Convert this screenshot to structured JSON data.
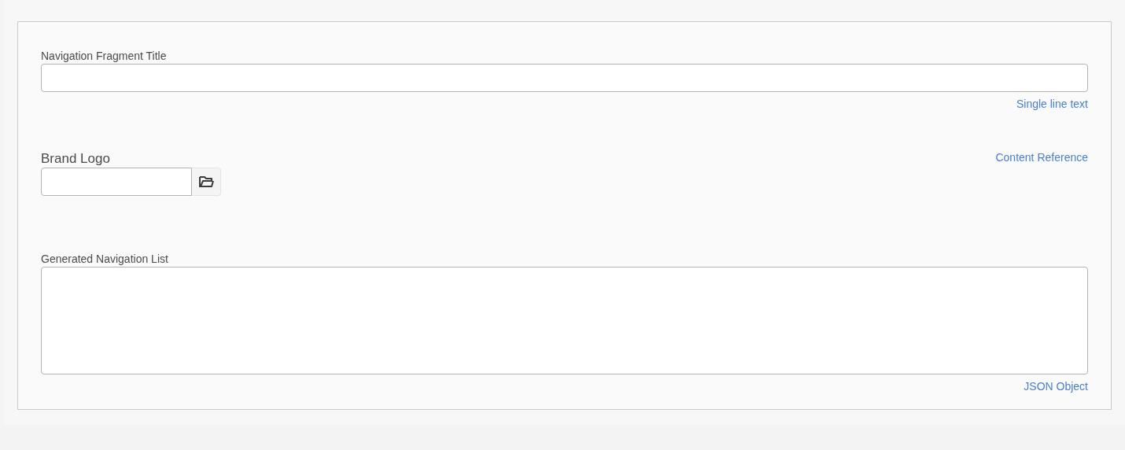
{
  "fields": [
    {
      "kind": "text",
      "label": "Navigation Fragment Title",
      "type_label": "Single line text"
    },
    {
      "kind": "reference",
      "label": "Brand Logo",
      "type_label": "Content Reference"
    },
    {
      "kind": "textarea",
      "label": "Generated Navigation List",
      "type_label": "JSON Object"
    }
  ]
}
